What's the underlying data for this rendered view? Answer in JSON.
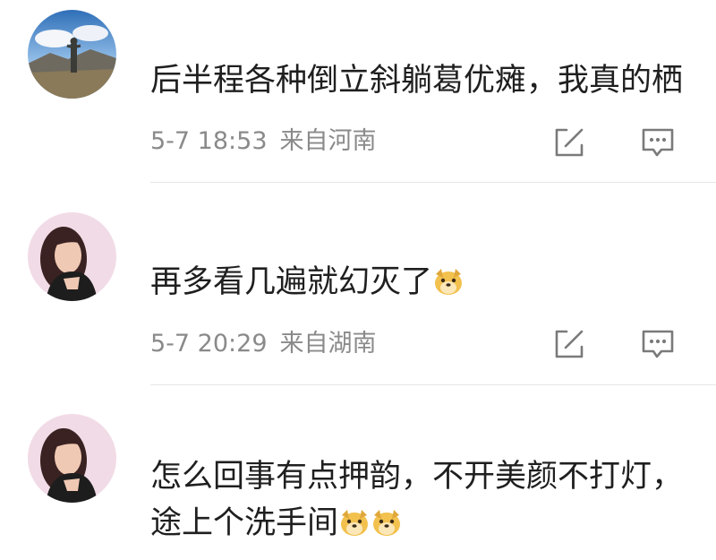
{
  "comments": [
    {
      "text": "后半程各种倒立斜躺葛优瘫，我真的栖",
      "timestamp": "5-7 18:53",
      "location": "来自河南",
      "avatar": "landscape-photo"
    },
    {
      "text": "再多看几遍就幻灭了",
      "emoji": "doge-emoji",
      "timestamp": "5-7 20:29",
      "location": "来自湖南",
      "avatar": "woman-portrait"
    },
    {
      "text_line1": "怎么回事有点押韵，不开美颜不打灯，",
      "text_line2": "途上个洗手间",
      "emoji": "doge-emoji",
      "avatar": "woman-portrait"
    }
  ],
  "actions": {
    "share_icon": "edit-share-icon",
    "reply_icon": "comment-icon"
  },
  "colors": {
    "text": "#1f1f1f",
    "meta": "#8a8a8a",
    "divider": "#e6e6e6",
    "emoji": "#f2c14e"
  }
}
